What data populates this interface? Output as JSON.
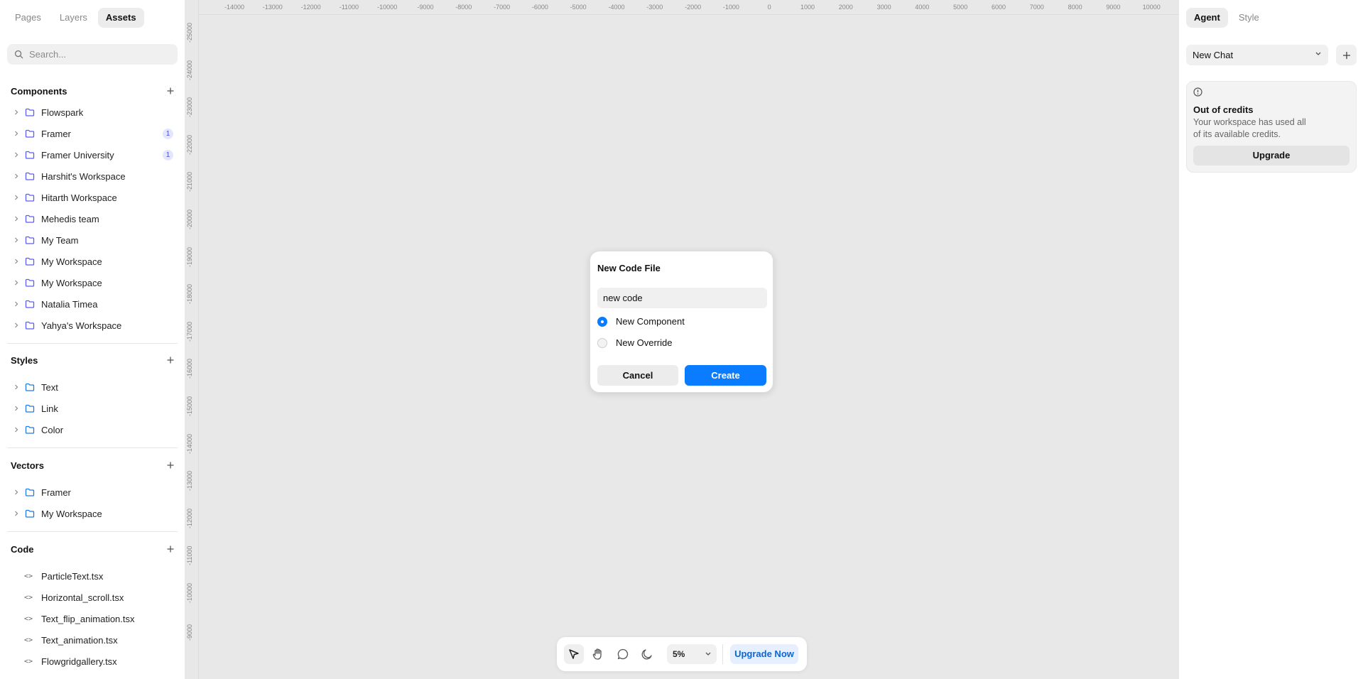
{
  "left_panel": {
    "tabs": [
      {
        "label": "Pages"
      },
      {
        "label": "Layers"
      },
      {
        "label": "Assets"
      }
    ],
    "search_placeholder": "Search...",
    "components": {
      "title": "Components",
      "items": [
        {
          "label": "Flowspark",
          "badge": ""
        },
        {
          "label": "Framer",
          "badge": "1"
        },
        {
          "label": "Framer University",
          "badge": "1"
        },
        {
          "label": "Harshit's Workspace",
          "badge": ""
        },
        {
          "label": "Hitarth Workspace",
          "badge": ""
        },
        {
          "label": "Mehedis team",
          "badge": ""
        },
        {
          "label": "My Team",
          "badge": ""
        },
        {
          "label": "My Workspace",
          "badge": ""
        },
        {
          "label": "My Workspace",
          "badge": ""
        },
        {
          "label": "Natalia Timea",
          "badge": ""
        },
        {
          "label": "Yahya's Workspace",
          "badge": ""
        }
      ]
    },
    "styles": {
      "title": "Styles",
      "items": [
        {
          "label": "Text"
        },
        {
          "label": "Link"
        },
        {
          "label": "Color"
        }
      ]
    },
    "vectors": {
      "title": "Vectors",
      "items": [
        {
          "label": "Framer"
        },
        {
          "label": "My Workspace"
        }
      ]
    },
    "code": {
      "title": "Code",
      "items": [
        {
          "label": "ParticleText.tsx"
        },
        {
          "label": "Horizontal_scroll.tsx"
        },
        {
          "label": "Text_flip_animation.tsx"
        },
        {
          "label": "Text_animation.tsx"
        },
        {
          "label": "Flowgridgallery.tsx"
        }
      ]
    }
  },
  "canvas": {
    "ruler_x": [
      "-14000",
      "-13000",
      "-12000",
      "-11000",
      "-10000",
      "-9000",
      "-8000",
      "-7000",
      "-6000",
      "-5000",
      "-4000",
      "-3000",
      "-2000",
      "-1000",
      "0",
      "1000",
      "2000",
      "3000",
      "4000",
      "5000",
      "6000",
      "7000",
      "8000",
      "9000",
      "10000"
    ],
    "ruler_y": [
      "-25000",
      "-24000",
      "-23000",
      "-22000",
      "-21000",
      "-20000",
      "-19000",
      "-18000",
      "-17000",
      "-16000",
      "-15000",
      "-14000",
      "-13000",
      "-12000",
      "-11000",
      "-10000",
      "-9000"
    ]
  },
  "dialog": {
    "title": "New Code File",
    "input_value": "new code",
    "options": [
      {
        "label": "New Component",
        "selected": true
      },
      {
        "label": "New Override",
        "selected": false
      }
    ],
    "cancel_label": "Cancel",
    "create_label": "Create"
  },
  "toolbar": {
    "tools": [
      "cursor-icon",
      "hand-icon",
      "comment-icon",
      "moon-icon"
    ],
    "zoom": "5%",
    "upgrade_label": "Upgrade Now"
  },
  "right_panel": {
    "tabs": [
      {
        "label": "Agent"
      },
      {
        "label": "Style"
      }
    ],
    "chat_select": "New Chat",
    "credits": {
      "title": "Out of credits",
      "description": "Your workspace has used all of its available credits.",
      "button": "Upgrade"
    }
  },
  "colors": {
    "accent": "#0a7cff",
    "folder_icon": "#5a5ff0",
    "canvas_bg": "#e8e8e8"
  }
}
